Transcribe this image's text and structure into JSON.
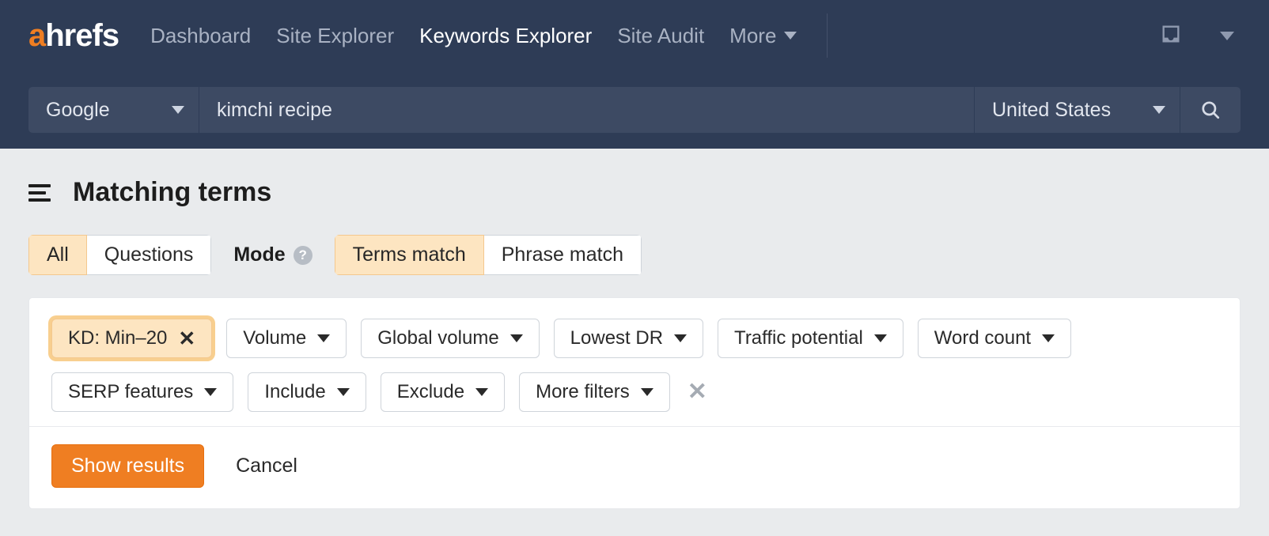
{
  "brand": {
    "accent_letter": "a",
    "rest": "hrefs",
    "accent_color": "#ef7e22"
  },
  "nav": {
    "items": [
      {
        "label": "Dashboard"
      },
      {
        "label": "Site Explorer"
      },
      {
        "label": "Keywords Explorer",
        "active": true
      },
      {
        "label": "Site Audit"
      }
    ],
    "more_label": "More"
  },
  "searchbar": {
    "engine": "Google",
    "query": "kimchi recipe",
    "country": "United States"
  },
  "page": {
    "title": "Matching terms"
  },
  "tabs": {
    "all": "All",
    "questions": "Questions",
    "mode_label": "Mode",
    "terms_match": "Terms match",
    "phrase_match": "Phrase match"
  },
  "filters": {
    "kd": "KD: Min–20",
    "volume": "Volume",
    "global_volume": "Global volume",
    "lowest_dr": "Lowest DR",
    "traffic_potential": "Traffic potential",
    "word_count": "Word count",
    "serp_features": "SERP features",
    "include": "Include",
    "exclude": "Exclude",
    "more_filters": "More filters"
  },
  "actions": {
    "show_results": "Show results",
    "cancel": "Cancel"
  }
}
